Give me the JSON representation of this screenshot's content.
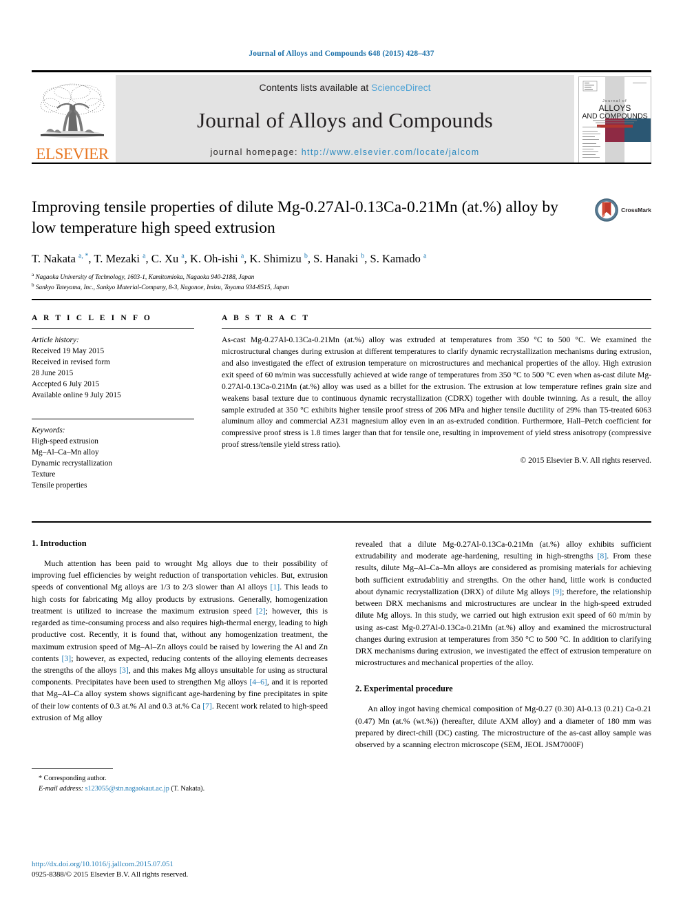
{
  "running_head": "Journal of Alloys and Compounds 648 (2015) 428–437",
  "masthead": {
    "contents_prefix": "Contents lists available at ",
    "sciencedirect": "ScienceDirect",
    "journal_title": "Journal of Alloys and Compounds",
    "homepage_prefix": "journal homepage: ",
    "homepage_url": "http://www.elsevier.com/locate/jalcom",
    "publisher": "ELSEVIER",
    "cover_title_line1": "Journal of",
    "cover_title_line2": "ALLOYS",
    "cover_title_line3": "AND COMPOUNDS",
    "link_color": "#2e8bc0",
    "brand_color": "#e87722"
  },
  "article": {
    "title": "Improving tensile properties of dilute Mg-0.27Al-0.13Ca-0.21Mn (at.%) alloy by low temperature high speed extrusion",
    "crossmark_label": "CrossMark",
    "authors_html": "T. Nakata <sup>a, *</sup>, T. Mezaki <sup>a</sup>, C. Xu <sup>a</sup>, K. Oh-ishi <sup>a</sup>, K. Shimizu <sup>b</sup>, S. Hanaki <sup>b</sup>, S. Kamado <sup>a</sup>",
    "affiliations": [
      "Nagaoka University of Technology, 1603-1, Kamitomioka, Nagaoka 940-2188, Japan",
      "Sankyo Tateyama, Inc., Sankyo Material-Company, 8-3, Nagonoe, Imizu, Toyama 934-8515, Japan"
    ],
    "affiliation_marks": [
      "a",
      "b"
    ]
  },
  "article_info": {
    "heading": "A R T I C L E  I N F O",
    "history_label": "Article history:",
    "history_lines": [
      "Received 19 May 2015",
      "Received in revised form",
      "28 June 2015",
      "Accepted 6 July 2015",
      "Available online 9 July 2015"
    ],
    "keywords_label": "Keywords:",
    "keywords": [
      "High-speed extrusion",
      "Mg–Al–Ca–Mn alloy",
      "Dynamic recrystallization",
      "Texture",
      "Tensile properties"
    ]
  },
  "abstract": {
    "heading": "A B S T R A C T",
    "text": "As-cast Mg-0.27Al-0.13Ca-0.21Mn (at.%) alloy was extruded at temperatures from 350 °C to 500 °C. We examined the microstructural changes during extrusion at different temperatures to clarify dynamic recrystallization mechanisms during extrusion, and also investigated the effect of extrusion temperature on microstructures and mechanical properties of the alloy. High extrusion exit speed of 60 m/min was successfully achieved at wide range of temperatures from 350 °C to 500 °C even when as-cast dilute Mg-0.27Al-0.13Ca-0.21Mn (at.%) alloy was used as a billet for the extrusion. The extrusion at low temperature refines grain size and weakens basal texture due to continuous dynamic recrystallization (CDRX) together with double twinning. As a result, the alloy sample extruded at 350 °C exhibits higher tensile proof stress of 206 MPa and higher tensile ductility of 29% than T5-treated 6063 aluminum alloy and commercial AZ31 magnesium alloy even in an as-extruded condition. Furthermore, Hall–Petch coefficient for compressive proof stress is 1.8 times larger than that for tensile one, resulting in improvement of yield stress anisotropy (compressive proof stress/tensile yield stress ratio).",
    "copyright": "© 2015 Elsevier B.V. All rights reserved."
  },
  "sections": {
    "intro_heading": "1.  Introduction",
    "intro_p1_html": "Much attention has been paid to wrought Mg alloys due to their possibility of improving fuel efficiencies by weight reduction of transportation vehicles. But, extrusion speeds of conventional Mg alloys are 1/3 to 2/3 slower than Al alloys <span class=\"ref\">[1]</span>. This leads to high costs for fabricating Mg alloy products by extrusions. Generally, homogenization treatment is utilized to increase the maximum extrusion speed <span class=\"ref\">[2]</span>; however, this is regarded as time-consuming process and also requires high-thermal energy, leading to high productive cost. Recently, it is found that, without any homogenization treatment, the maximum extrusion speed of Mg–Al–Zn alloys could be raised by lowering the Al and Zn contents <span class=\"ref\">[3]</span>; however, as expected, reducing contents of the alloying elements decreases the strengths of the alloys <span class=\"ref\">[3]</span>, and this makes Mg alloys unsuitable for using as structural components. Precipitates have been used to strengthen Mg alloys <span class=\"ref\">[4–6]</span>, and it is reported that Mg–Al–Ca alloy system shows significant age-hardening by fine precipitates in spite of their low contents of 0.3 at.% Al and 0.3 at.% Ca <span class=\"ref\">[7]</span>. Recent work related to high-speed extrusion of Mg alloy",
    "intro_p2_html": "revealed that a dilute Mg-0.27Al-0.13Ca-0.21Mn (at.%) alloy exhibits sufficient extrudability and moderate age-hardening, resulting in high-strengths <span class=\"ref\">[8]</span>. From these results, dilute Mg–Al–Ca–Mn alloys are considered as promising materials for achieving both sufficient extrudablitiy and strengths. On the other hand, little work is conducted about dynamic recrystallization (DRX) of dilute Mg alloys <span class=\"ref\">[9]</span>; therefore, the relationship between DRX mechanisms and microstructures are unclear in the high-speed extruded dilute Mg alloys. In this study, we carried out high extrusion exit speed of 60 m/min by using as-cast Mg-0.27Al-0.13Ca-0.21Mn (at.%) alloy and examined the microstructural changes during extrusion at temperatures from 350 °C to 500 °C. In addition to clarifying DRX mechanisms during extrusion, we investigated the effect of extrusion temperature on microstructures and mechanical properties of the alloy.",
    "exp_heading": "2.  Experimental procedure",
    "exp_p1_html": "An alloy ingot having chemical composition of Mg-0.27 (0.30) Al-0.13 (0.21) Ca-0.21 (0.47) Mn (at.% (wt.%)) (hereafter, dilute AXM alloy) and a diameter of 180 mm was prepared by direct-chill (DC) casting. The microstructure of the as-cast alloy sample was observed by a scanning electron microscope (SEM, JEOL JSM7000F)"
  },
  "footnote": {
    "corresponding": "* Corresponding author.",
    "email_label": "E-mail address:",
    "email": "s123055@stn.nagaokaut.ac.jp",
    "email_suffix": "(T. Nakata)."
  },
  "footer": {
    "doi": "http://dx.doi.org/10.1016/j.jallcom.2015.07.051",
    "issn": "0925-8388/© 2015 Elsevier B.V. All rights reserved."
  }
}
